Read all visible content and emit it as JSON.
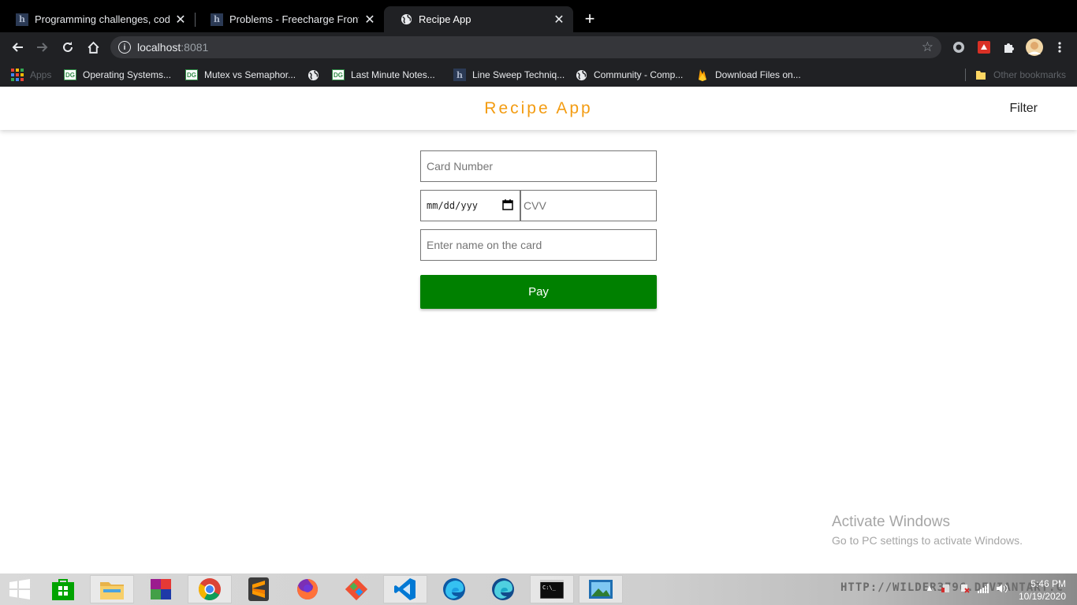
{
  "browser": {
    "tabs": [
      {
        "title": "Programming challenges, coding",
        "icon": "hackerrank-icon"
      },
      {
        "title": "Problems - Freecharge Frontend",
        "icon": "hackerrank-icon"
      },
      {
        "title": "Recipe App",
        "icon": "globe-icon",
        "active": true
      }
    ],
    "new_tab": "+",
    "url_host": "localhost",
    "url_port": ":8081",
    "bookmarks": [
      {
        "label": "Apps",
        "icon": "apps-grid-icon"
      },
      {
        "label": "Operating Systems...",
        "icon": "gfg-icon"
      },
      {
        "label": "Mutex vs Semaphor...",
        "icon": "gfg-icon"
      },
      {
        "label": "",
        "icon": "globe-icon"
      },
      {
        "label": "Last Minute Notes...",
        "icon": "gfg-icon"
      },
      {
        "label": "Line Sweep Techniq...",
        "icon": "hackerrank-icon"
      },
      {
        "label": "Community - Comp...",
        "icon": "globe-icon"
      },
      {
        "label": "Download Files on...",
        "icon": "firebase-icon"
      }
    ],
    "other_bookmarks": "Other bookmarks"
  },
  "app": {
    "title": "Recipe App",
    "filter_label": "Filter",
    "title_color": "#f39c12"
  },
  "form": {
    "card_number_placeholder": "Card Number",
    "date_placeholder": "mm/dd/yyyy",
    "date_display": "mm/dd/yyy",
    "cvv_placeholder": "CVV",
    "name_placeholder": "Enter name on the card",
    "pay_label": "Pay",
    "pay_color": "#008000"
  },
  "watermark": {
    "line1": "Activate Windows",
    "line2": "Go to PC settings to activate Windows."
  },
  "taskbar": {
    "apps": [
      "windows-start-icon",
      "store-icon",
      "file-explorer-icon",
      "winrar-icon",
      "chrome-icon",
      "sublime-icon",
      "firefox-icon",
      "git-icon",
      "vscode-icon",
      "edge-icon",
      "edge-beta-icon",
      "cmd-icon",
      "photos-icon"
    ],
    "wallpaper_text": "HTTP://WILDER3796.DEVIANTART.C",
    "time": "5:46 PM",
    "date": "10/19/2020"
  }
}
